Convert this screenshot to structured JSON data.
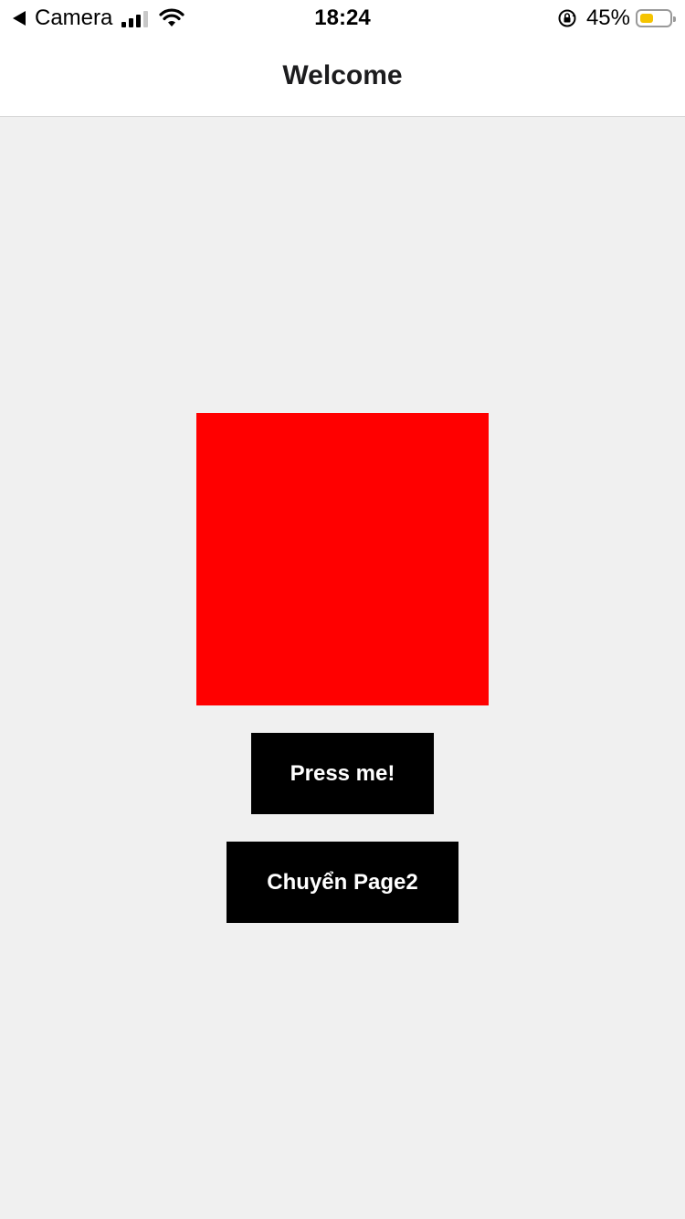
{
  "status_bar": {
    "back_app": "Camera",
    "time": "18:24",
    "battery_percent": "45%",
    "battery_level": 0.45,
    "battery_color": "#f5c400",
    "icons": [
      "back-triangle-icon",
      "signal-icon",
      "wifi-icon",
      "orientation-lock-icon",
      "battery-icon"
    ]
  },
  "nav": {
    "title": "Welcome"
  },
  "main": {
    "box_color": "#ff0000",
    "press_button_label": "Press me!",
    "page2_button_label": "Chuyển Page2"
  }
}
